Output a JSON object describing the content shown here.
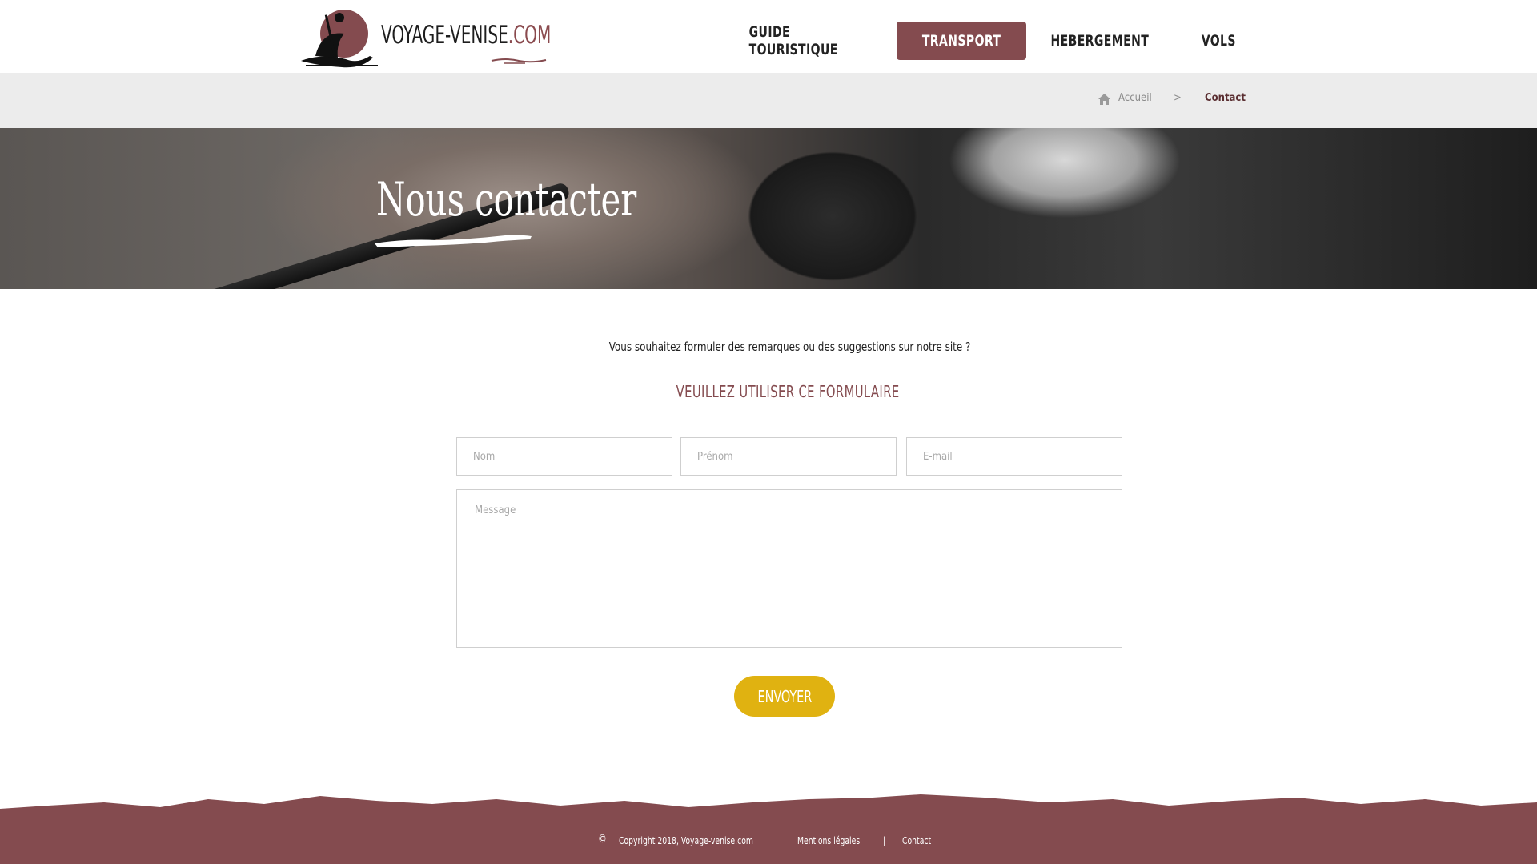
{
  "logo": {
    "text_main": "VOYAGE-VENISE",
    "text_accent": ".COM"
  },
  "nav": {
    "items": [
      {
        "label": "GUIDE TOURISTIQUE",
        "active": false
      },
      {
        "label": "TRANSPORT",
        "active": true
      },
      {
        "label": "HEBERGEMENT",
        "active": false
      },
      {
        "label": "VOLS",
        "active": false
      }
    ]
  },
  "breadcrumb": {
    "home_label": "Accueil",
    "separator": ">",
    "current": "Contact"
  },
  "hero": {
    "title": "Nous contacter"
  },
  "intro": {
    "question": "Vous souhaitez formuler des remarques ou des suggestions sur notre site ?",
    "subheading": "VEUILLEZ UTILISER CE FORMULAIRE"
  },
  "form": {
    "nom_placeholder": "Nom",
    "prenom_placeholder": "Prénom",
    "email_placeholder": "E-mail",
    "message_placeholder": "Message",
    "submit_label": "ENVOYER"
  },
  "footer": {
    "copyright_symbol": "©",
    "copyright": "Copyright 2018, Voyage-venise.com",
    "separator": "|",
    "legal": "Mentions légales",
    "contact": "Contact"
  },
  "colors": {
    "brand": "#844b4f",
    "button": "#e0b211",
    "breadcrumb_bg": "#ececec"
  }
}
